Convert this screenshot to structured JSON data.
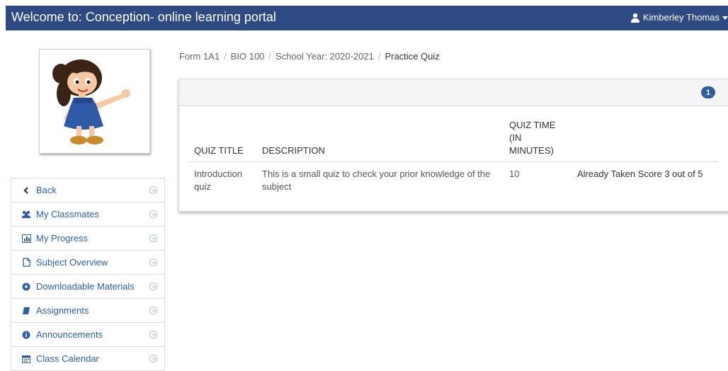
{
  "header": {
    "title": "Welcome to: Conception- online learning portal",
    "user_name": "Kimberley Thomas",
    "user_icon": "user-icon"
  },
  "sidebar": {
    "items": [
      {
        "label": "Back",
        "icon": "chevron-left-icon"
      },
      {
        "label": "My Classmates",
        "icon": "users-icon"
      },
      {
        "label": "My Progress",
        "icon": "bar-chart-icon"
      },
      {
        "label": "Subject Overview",
        "icon": "file-icon"
      },
      {
        "label": "Downloadable Materials",
        "icon": "download-icon"
      },
      {
        "label": "Assignments",
        "icon": "book-icon"
      },
      {
        "label": "Announcements",
        "icon": "info-icon"
      },
      {
        "label": "Class Calendar",
        "icon": "calendar-icon"
      }
    ]
  },
  "breadcrumb": {
    "items": [
      "Form 1A1",
      "BIO 100",
      "School Year: 2020-2021",
      "Practice Quiz"
    ],
    "separator": "/"
  },
  "panel": {
    "badge_count": "1"
  },
  "quiz_table": {
    "headers": {
      "title": "QUIZ TITLE",
      "description": "DESCRIPTION",
      "time_line1": "QUIZ TIME (IN",
      "time_line2": "MINUTES)"
    },
    "rows": [
      {
        "title_line1": "Introduction",
        "title_line2": "quiz",
        "description_line1": "This is a small quiz to check your prior knowledge of the",
        "description_line2": "subject",
        "time": "10",
        "status": "Already Taken Score 3 out of 5"
      }
    ]
  },
  "colors": {
    "header_bg": "#2e4a83",
    "link": "#2e5fa5",
    "badge": "#2f5f9e"
  }
}
